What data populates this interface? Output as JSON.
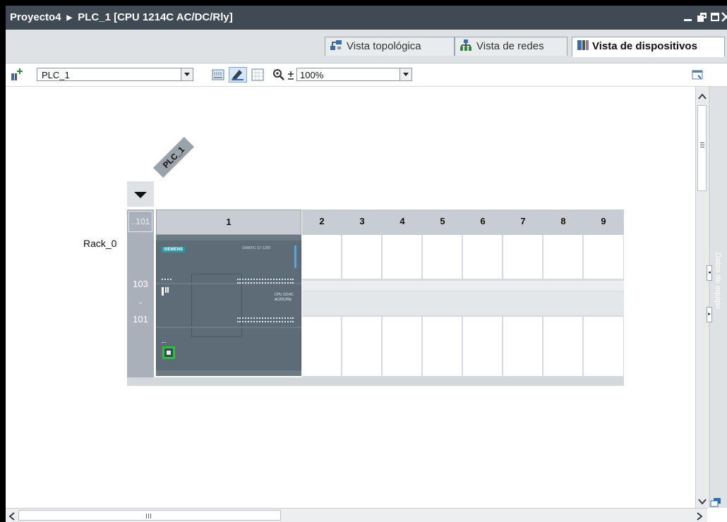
{
  "titlebar": {
    "project": "Proyecto4",
    "device": "PLC_1 [CPU 1214C AC/DC/Rly]"
  },
  "tabs": [
    {
      "label": "Vista topológica",
      "active": false
    },
    {
      "label": "Vista de redes",
      "active": false
    },
    {
      "label": "Vista de dispositivos",
      "active": true
    }
  ],
  "toolbar": {
    "device_select": "PLC_1",
    "zoom_select": "100%"
  },
  "rack": {
    "device_tag": "PLC_1",
    "rack_label": "Rack_0",
    "left_header": "..101",
    "left_col_top": "103",
    "left_col_mid": "-",
    "left_col_bottom": "101",
    "slots": [
      "1",
      "2",
      "3",
      "4",
      "5",
      "6",
      "7",
      "8",
      "9"
    ]
  },
  "cpu_module": {
    "brand": "SIEMENS",
    "family": "SIMATIC S7-1200",
    "model_line1": "CPU 1214C",
    "model_line2": "AC/DC/Rly"
  },
  "side_panel": {
    "label": "Datos de equipo"
  },
  "colors": {
    "titlebar_bg": "#3f4a54",
    "rack_header": "#c8cdd3",
    "cpu_body": "#5e6c77",
    "slot_band": "#e6e8eb",
    "port_green": "#27c33b"
  }
}
